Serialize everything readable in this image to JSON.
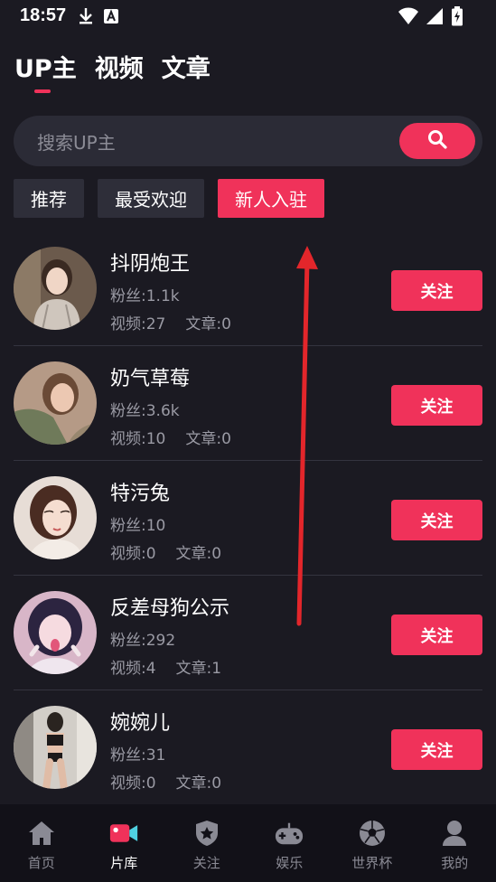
{
  "status_bar": {
    "time": "18:57",
    "left_icons": [
      "download-icon",
      "a-badge-icon"
    ],
    "right_icons": [
      "wifi-icon",
      "signal-icon",
      "battery-charging-icon"
    ]
  },
  "top_tabs": [
    {
      "label": "UP主",
      "active": true
    },
    {
      "label": "视频",
      "active": false
    },
    {
      "label": "文章",
      "active": false
    }
  ],
  "search": {
    "placeholder": "搜索UP主",
    "value": "",
    "button_icon": "search-icon"
  },
  "filters": [
    {
      "label": "推荐",
      "active": false
    },
    {
      "label": "最受欢迎",
      "active": false
    },
    {
      "label": "新人入驻",
      "active": true
    }
  ],
  "creators": [
    {
      "name": "抖阴炮王",
      "fans": "粉丝:1.1k",
      "videos": "视频:27",
      "articles": "文章:0",
      "follow_label": "关注"
    },
    {
      "name": "奶气草莓",
      "fans": "粉丝:3.6k",
      "videos": "视频:10",
      "articles": "文章:0",
      "follow_label": "关注"
    },
    {
      "name": "特污兔",
      "fans": "粉丝:10",
      "videos": "视频:0",
      "articles": "文章:0",
      "follow_label": "关注"
    },
    {
      "name": "反差母狗公示",
      "fans": "粉丝:292",
      "videos": "视频:4",
      "articles": "文章:1",
      "follow_label": "关注"
    },
    {
      "name": "婉婉儿",
      "fans": "粉丝:31",
      "videos": "视频:0",
      "articles": "文章:0",
      "follow_label": "关注"
    }
  ],
  "bottom_nav": [
    {
      "label": "首页",
      "icon": "home-icon",
      "active": false
    },
    {
      "label": "片库",
      "icon": "video-camera-icon",
      "active": true
    },
    {
      "label": "关注",
      "icon": "star-shield-icon",
      "active": false
    },
    {
      "label": "娱乐",
      "icon": "gamepad-icon",
      "active": false
    },
    {
      "label": "世界杯",
      "icon": "soccer-ball-icon",
      "active": false
    },
    {
      "label": "我的",
      "icon": "user-icon",
      "active": false
    }
  ],
  "colors": {
    "accent": "#f0325a",
    "background": "#1b1a22",
    "annotation_arrow": "#e3262b"
  }
}
